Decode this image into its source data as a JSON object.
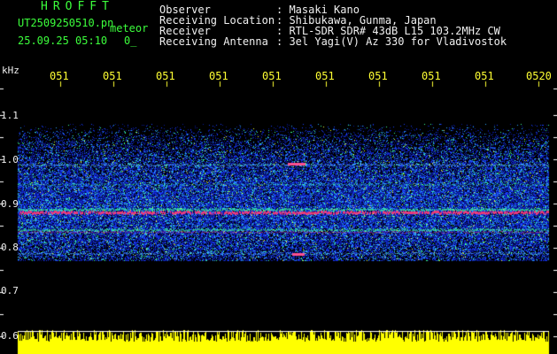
{
  "app": {
    "logo": "HROFFT",
    "file_name": "UT2509250510.pn",
    "mode_label": "meteor",
    "datetime": "25.09.25 05:10",
    "extra": "0_"
  },
  "header": {
    "rows": [
      {
        "label": "Observer",
        "value": ": Masaki Kano"
      },
      {
        "label": "Receiving Location",
        "value": ": Shibukawa, Gunma, Japan"
      },
      {
        "label": "Receiver",
        "value": ": RTL-SDR SDR# 43dB L15 103.2MHz CW"
      },
      {
        "label": "Receiving Antenna",
        "value": ": 3el Yagi(V) Az 330 for Vladivostok"
      }
    ]
  },
  "axis": {
    "unit_label": "kHz",
    "time_ticks": [
      "051",
      "051",
      "051",
      "051",
      "051",
      "051",
      "051",
      "051",
      "051",
      "0520"
    ],
    "freq_ticks": [
      "1.1",
      "1.0",
      "0.9",
      "0.8",
      "0.7",
      "0.6"
    ]
  },
  "colors": {
    "text_green": "#3cff3c",
    "text_yellow": "#ffff33",
    "noise_band": "#1a3cff",
    "signal_line": "#ff3c78",
    "amplitude": "#ffff00"
  }
}
